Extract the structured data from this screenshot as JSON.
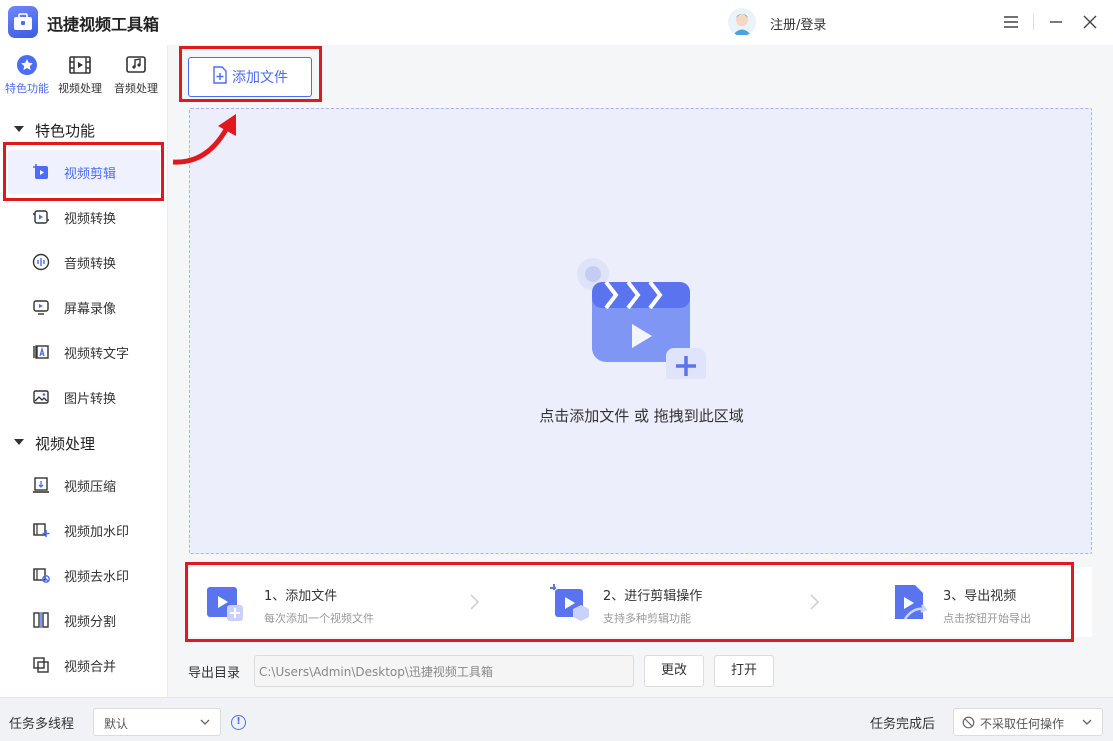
{
  "titlebar": {
    "app_title": "迅捷视频工具箱",
    "login_label": "注册/登录",
    "icons": [
      "app-logo-icon",
      "avatar-icon",
      "menu-icon",
      "minimize-icon",
      "close-icon"
    ]
  },
  "sidebar": {
    "category_tabs": [
      {
        "label": "特色功能",
        "icon": "star-icon",
        "active": true
      },
      {
        "label": "视频处理",
        "icon": "film-icon",
        "active": false
      },
      {
        "label": "音频处理",
        "icon": "music-icon",
        "active": false
      }
    ],
    "groups": [
      {
        "title": "特色功能",
        "items": [
          {
            "label": "视频剪辑",
            "icon": "video-edit-icon",
            "active": true
          },
          {
            "label": "视频转换",
            "icon": "video-convert-icon"
          },
          {
            "label": "音频转换",
            "icon": "audio-convert-icon"
          },
          {
            "label": "屏幕录像",
            "icon": "screen-record-icon"
          },
          {
            "label": "视频转文字",
            "icon": "video-to-text-icon"
          },
          {
            "label": "图片转换",
            "icon": "image-convert-icon"
          }
        ]
      },
      {
        "title": "视频处理",
        "items": [
          {
            "label": "视频压缩",
            "icon": "video-compress-icon"
          },
          {
            "label": "视频加水印",
            "icon": "add-watermark-icon"
          },
          {
            "label": "视频去水印",
            "icon": "remove-watermark-icon"
          },
          {
            "label": "视频分割",
            "icon": "video-split-icon"
          },
          {
            "label": "视频合并",
            "icon": "video-merge-icon"
          }
        ]
      }
    ]
  },
  "main": {
    "add_file_label": "添加文件",
    "drop_text": "点击添加文件 或 拖拽到此区域",
    "steps": [
      {
        "title": "1、添加文件",
        "desc": "每次添加一个视频文件"
      },
      {
        "title": "2、进行剪辑操作",
        "desc": "支持多种剪辑功能"
      },
      {
        "title": "3、导出视频",
        "desc": "点击按钮开始导出"
      }
    ],
    "export": {
      "label": "导出目录",
      "path": "C:\\Users\\Admin\\Desktop\\迅捷视频工具箱",
      "change_label": "更改",
      "open_label": "打开"
    }
  },
  "statusbar": {
    "threads_label": "任务多线程",
    "threads_value": "默认",
    "after_label": "任务完成后",
    "after_value": "不采取任何操作"
  },
  "colors": {
    "accent": "#4b6cf5",
    "annotation_red": "#e0191e",
    "drop_zone_bg": "#eceefb"
  }
}
